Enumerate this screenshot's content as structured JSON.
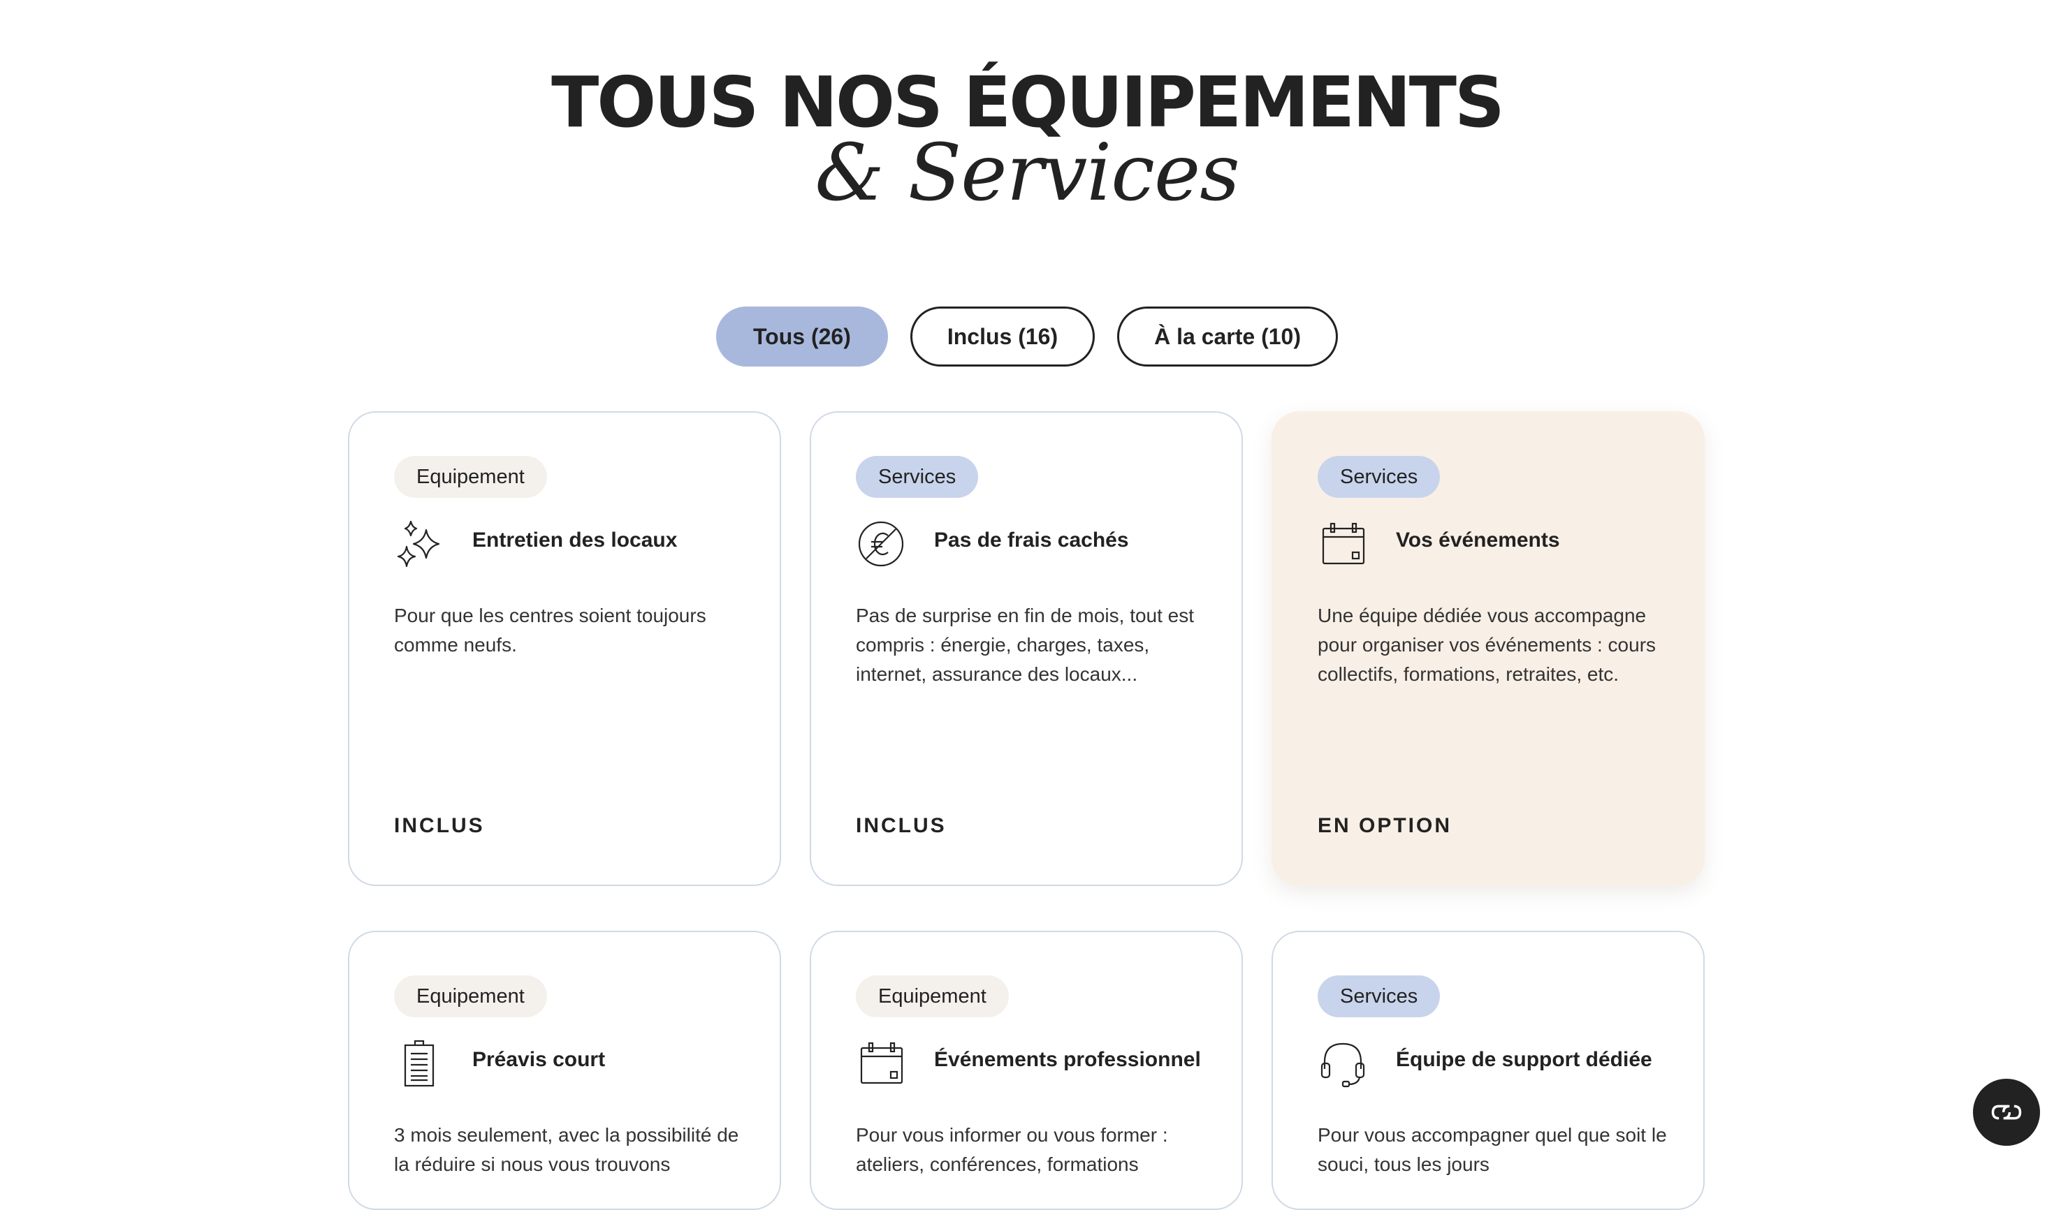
{
  "heading": {
    "line1": "TOUS NOS ÉQUIPEMENTS",
    "line2": "& Services"
  },
  "filters": [
    {
      "label": "Tous (26)",
      "active": true
    },
    {
      "label": "Inclus (16)",
      "active": false
    },
    {
      "label": "À la carte (10)",
      "active": false
    }
  ],
  "cards": [
    {
      "tag": "Equipement",
      "icon": "sparkles-icon",
      "title": "Entretien des locaux",
      "description": "Pour que les centres soient toujours comme neufs.",
      "status": "INCLUS"
    },
    {
      "tag": "Services",
      "icon": "no-euro-icon",
      "title": "Pas de frais cachés",
      "description": "Pas de surprise en fin de mois, tout est compris : énergie, charges, taxes, internet, assurance des locaux...",
      "status": "INCLUS"
    },
    {
      "tag": "Services",
      "icon": "calendar-icon",
      "title": "Vos événements",
      "description": "Une équipe dédiée vous accompagne pour organiser vos événements : cours collectifs, formations, retraites, etc.",
      "status": "EN OPTION"
    },
    {
      "tag": "Equipement",
      "icon": "clipboard-icon",
      "title": "Préavis court",
      "description": "3 mois seulement, avec la possibilité de la réduire si nous vous trouvons",
      "status": ""
    },
    {
      "tag": "Equipement",
      "icon": "calendar-icon",
      "title": "Événements professionnel",
      "description": "Pour vous informer ou vous former : ateliers, conférences, formations",
      "status": ""
    },
    {
      "tag": "Services",
      "icon": "headset-icon",
      "title": "Équipe de support dédiée",
      "description": "Pour vous accompagner quel que soit le souci, tous les jours",
      "status": ""
    }
  ],
  "chat": {
    "icon": "chat-icon"
  }
}
